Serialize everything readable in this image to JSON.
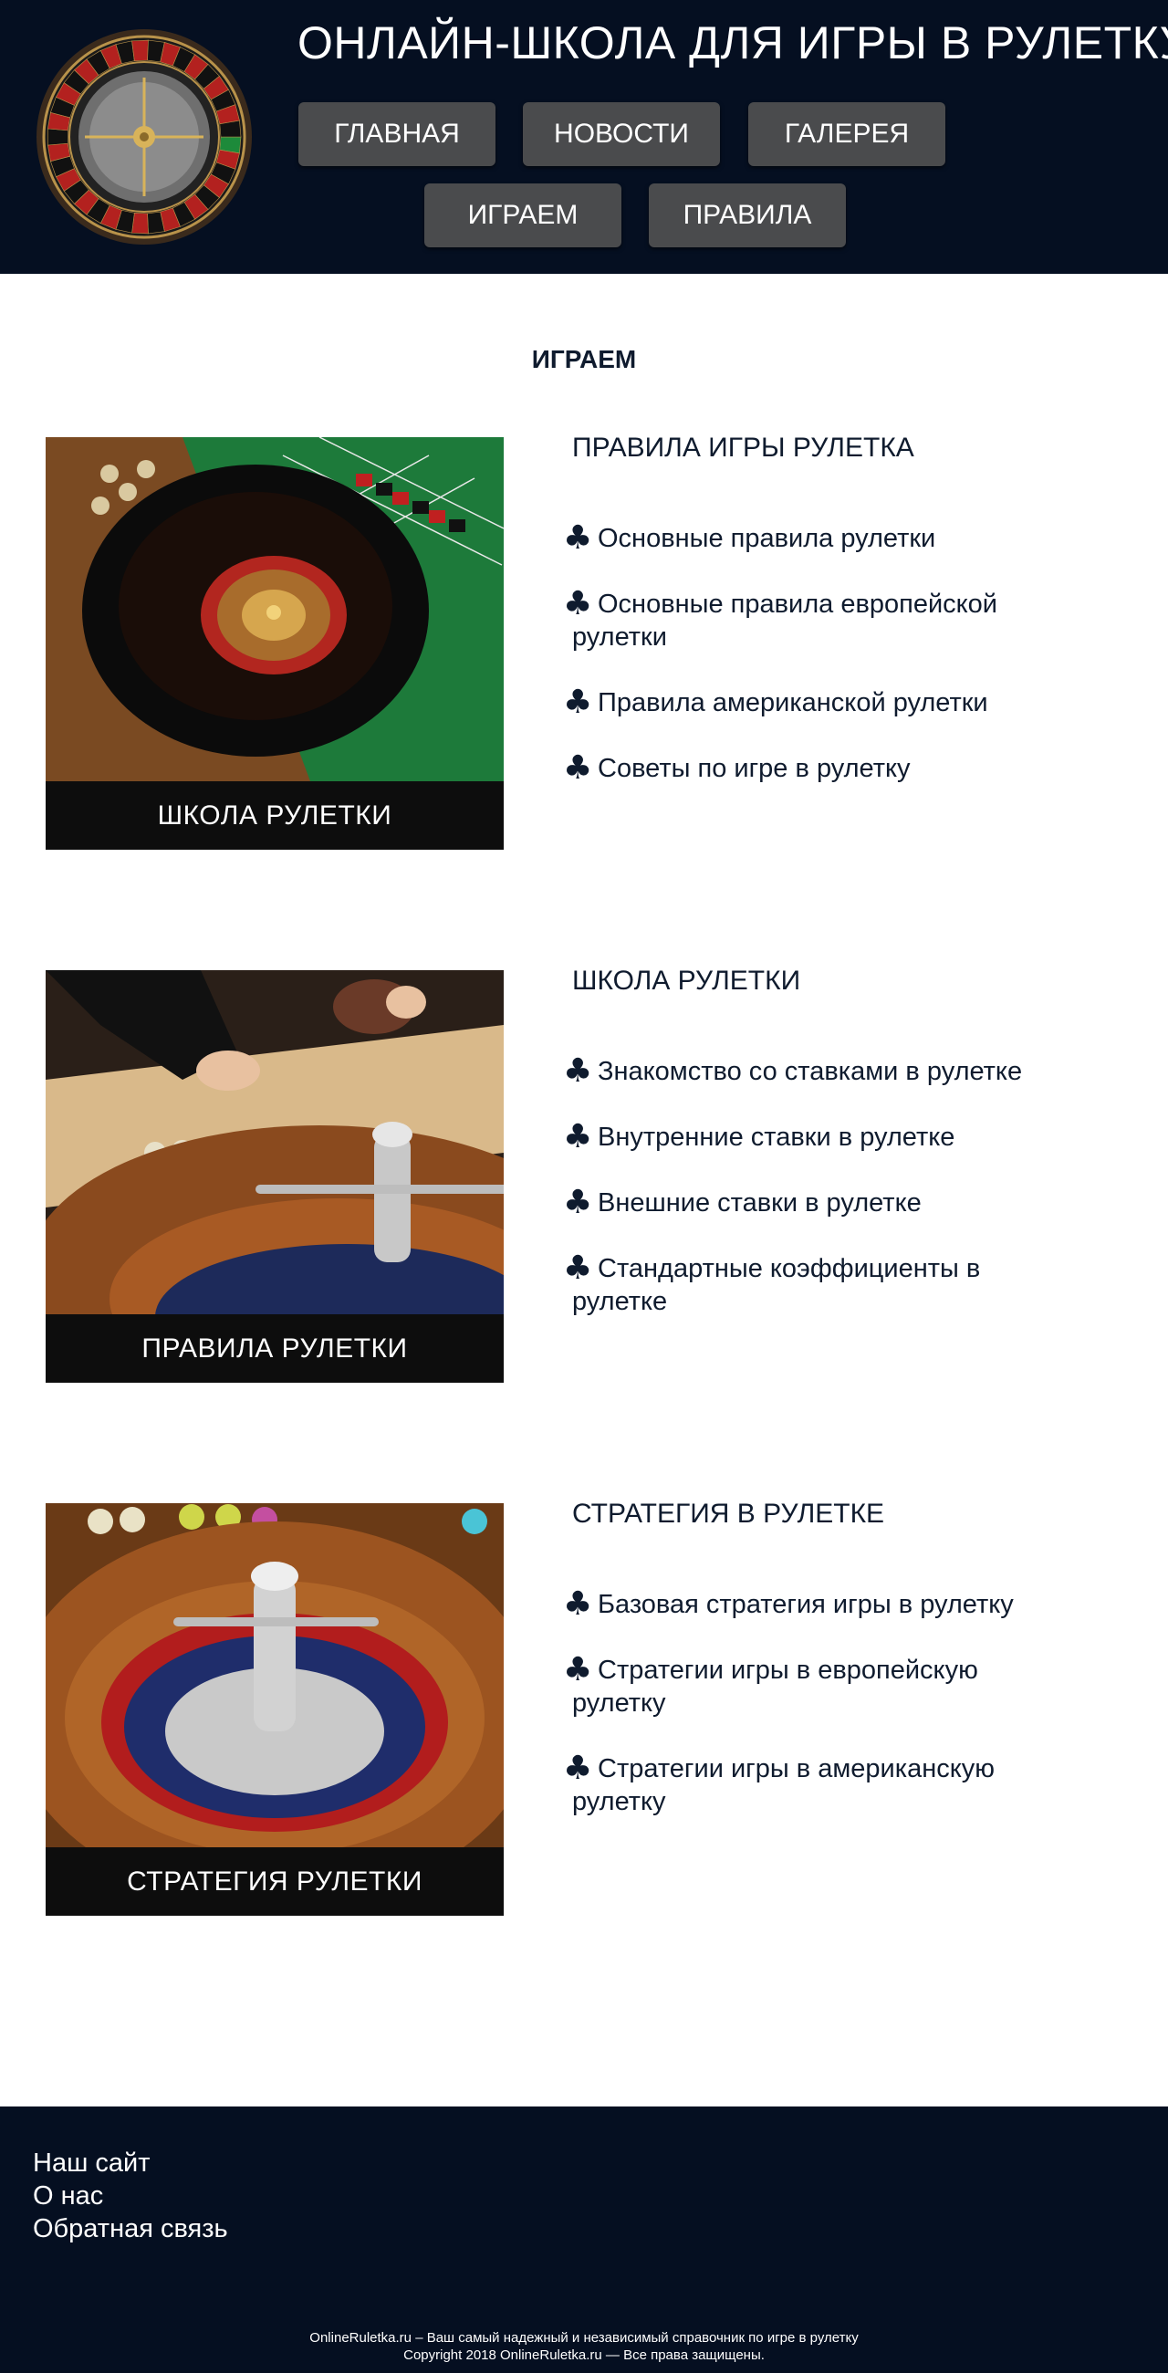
{
  "header": {
    "site_title": "ОНЛАЙН-ШКОЛА ДЛЯ ИГРЫ В РУЛЕТКУ",
    "nav": [
      {
        "label": "ГЛАВНАЯ"
      },
      {
        "label": "НОВОСТИ"
      },
      {
        "label": "ГАЛЕРЕЯ"
      },
      {
        "label": "ИГРАЕМ"
      },
      {
        "label": "ПРАВИЛА"
      }
    ]
  },
  "main": {
    "section_title": "ИГРАЕМ",
    "blocks": [
      {
        "card_caption": "ШКОЛА РУЛЕТКИ",
        "list_title": "ПРАВИЛА ИГРЫ РУЛЕТКА",
        "items": [
          "Основные правила рулетки",
          "Основные правила европейской рулетки",
          "Правила американской рулетки",
          "Советы по игре в рулетку"
        ]
      },
      {
        "card_caption": "ПРАВИЛА РУЛЕТКИ",
        "list_title": "ШКОЛА РУЛЕТКИ",
        "items": [
          "Знакомство со ставками в рулетке",
          "Внутренние ставки в рулетке",
          "Внешние ставки в рулетке",
          "Стандартные коэффициенты в рулетке"
        ]
      },
      {
        "card_caption": "СТРАТЕГИЯ РУЛЕТКИ",
        "list_title": "СТРАТЕГИЯ В РУЛЕТКЕ",
        "items": [
          "Базовая стратегия игры в рулетку",
          "Стратегии игры в европейскую рулетку",
          "Стратегии игры в американскую рулетку"
        ]
      }
    ],
    "bullet_icon": "club-icon"
  },
  "footer": {
    "links": [
      "Наш сайт",
      "О нас",
      "Обратная связь"
    ],
    "tagline": "OnlineRuletka.ru – Ваш самый надежный и независимый справочник по игре в рулетку",
    "copyright": "Copyright 2018 OnlineRuletka.ru — Все права защищены."
  },
  "colors": {
    "header_bg": "#050f21",
    "nav_button_bg": "#4a4b4d",
    "caption_bg": "#0d0d0d",
    "text_dark": "#0f1b2e"
  }
}
